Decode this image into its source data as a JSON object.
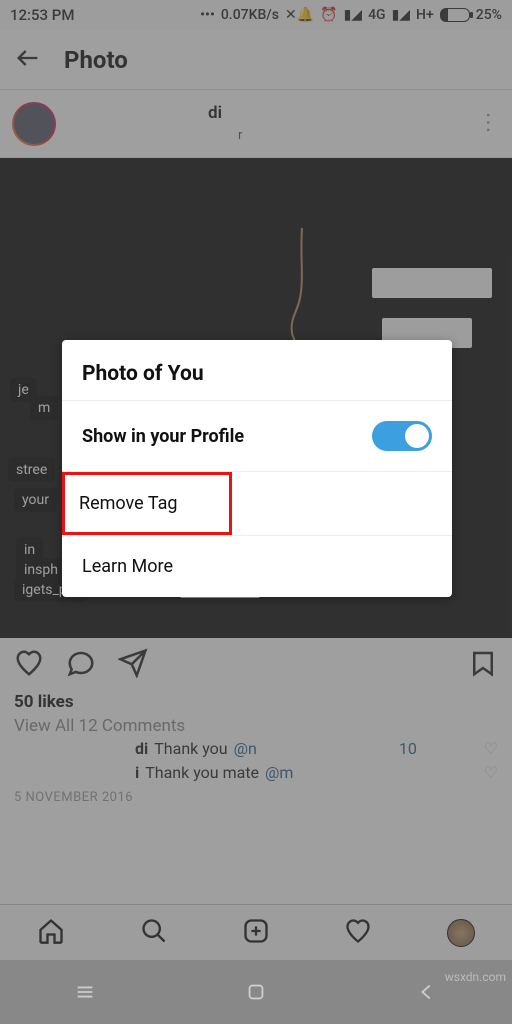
{
  "statusbar": {
    "time": "12:53 PM",
    "speed": "0.07KB/s",
    "net1": "4G",
    "net2": "H+",
    "battery": "25%"
  },
  "header": {
    "title": "Photo"
  },
  "post": {
    "username_suffix": "di",
    "location_suffix": "r"
  },
  "modal": {
    "title": "Photo of You",
    "show_label": "Show in your Profile",
    "remove_label": "Remove Tag",
    "learn_label": "Learn More"
  },
  "engagement": {
    "likes": "50 likes",
    "view_comments": "View All 12 Comments",
    "comment1_name_suffix": "di",
    "comment1_text": "Thank you",
    "comment1_mention_prefix": "@n",
    "comment1_mention_suffix": "10",
    "comment2_name_suffix": "i",
    "comment2_text": "Thank you mate",
    "comment2_mention_prefix": "@m",
    "date": "5 NOVEMBER 2016"
  },
  "watermark": "wsxdn.com"
}
